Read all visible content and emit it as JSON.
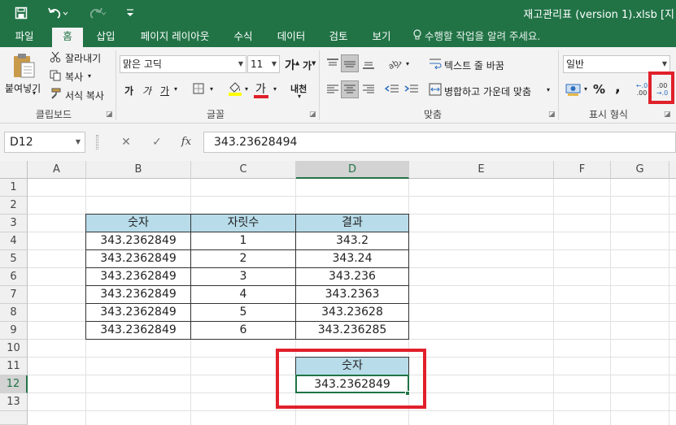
{
  "titlebar": {
    "title": "재고관리표 (version 1).xlsb [지"
  },
  "tabs": [
    "파일",
    "홈",
    "삽입",
    "페이지 레이아웃",
    "수식",
    "데이터",
    "검토",
    "보기"
  ],
  "tell_me": "수행할 작업을 알려 주세요.",
  "ribbon": {
    "clipboard": {
      "paste": "붙여넣기",
      "cut": "잘라내기",
      "copy": "복사",
      "format_painter": "서식 복사",
      "label": "클립보드"
    },
    "font": {
      "name": "맑은 고딕",
      "size": "11",
      "bold": "가",
      "italic": "가",
      "underline": "가",
      "grow": "가",
      "shrink": "가",
      "font_color_glyph": "가",
      "phonetic": "내천",
      "label": "글꼴"
    },
    "alignment": {
      "wrap_text": "텍스트 줄 바꿈",
      "merge_center": "병합하고 가운데 맞춤",
      "label": "맞춤"
    },
    "number": {
      "format": "일반",
      "percent": "%",
      "comma": ",",
      "inc_decimal": ".00",
      "dec_decimal": ".00",
      "label": "표시 형식"
    }
  },
  "formula_bar": {
    "cell_ref": "D12",
    "content": "343.23628494",
    "fx": "fx"
  },
  "grid": {
    "columns": [
      "A",
      "B",
      "C",
      "D",
      "E",
      "F",
      "G"
    ],
    "rows": [
      "1",
      "2",
      "3",
      "4",
      "5",
      "6",
      "7",
      "8",
      "9",
      "10",
      "11",
      "12",
      "13"
    ],
    "table": {
      "headers": [
        "숫자",
        "자릿수",
        "결과"
      ],
      "rows": [
        [
          "343.2362849",
          "1",
          "343.2"
        ],
        [
          "343.2362849",
          "2",
          "343.24"
        ],
        [
          "343.2362849",
          "3",
          "343.236"
        ],
        [
          "343.2362849",
          "4",
          "343.2363"
        ],
        [
          "343.2362849",
          "5",
          "343.23628"
        ],
        [
          "343.2362849",
          "6",
          "343.236285"
        ]
      ]
    },
    "single": {
      "header": "숫자",
      "value": "343.2362849"
    }
  },
  "colors": {
    "excel_green": "#217346",
    "header_fill": "#b8dce9",
    "highlight": "#e0202a"
  }
}
